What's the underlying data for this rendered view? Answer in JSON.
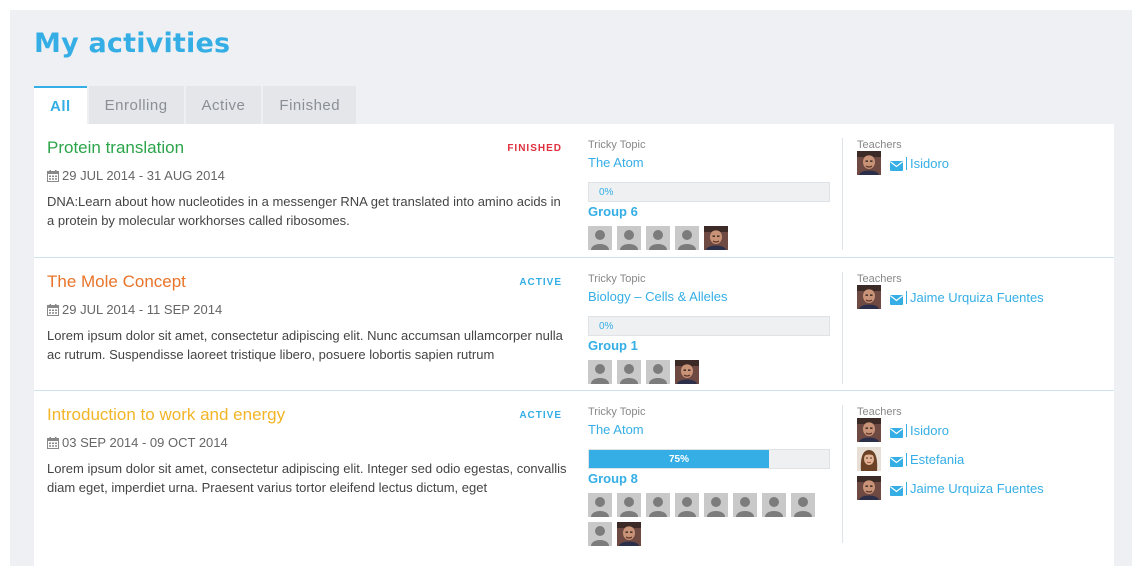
{
  "page": {
    "title": "My activities"
  },
  "tabs": [
    {
      "label": "All",
      "active": true
    },
    {
      "label": "Enrolling",
      "active": false
    },
    {
      "label": "Active",
      "active": false
    },
    {
      "label": "Finished",
      "active": false
    }
  ],
  "colors": {
    "accent": "#34aee5",
    "finished": "#e0303d",
    "active_badge": "#34aee5",
    "title_green": "#2ca44a",
    "title_orange": "#e8742a",
    "title_yellow": "#f2b527"
  },
  "labels": {
    "tricky_topic": "Tricky Topic",
    "teachers": "Teachers"
  },
  "activities": [
    {
      "title": "Protein translation",
      "title_color": "#2ca44a",
      "status": "FINISHED",
      "status_color": "#e0303d",
      "dates": "29 JUL 2014 - 31 AUG 2014",
      "description": "DNA:Learn about how nucleotides in a messenger RNA get translated into amino acids in a protein by molecular workhorses called ribosomes.",
      "topic": "The Atom",
      "progress": {
        "percent": 0,
        "label": "0%"
      },
      "group": "Group 6",
      "members": [
        "placeholder",
        "placeholder",
        "placeholder",
        "placeholder",
        "photo"
      ],
      "teachers": [
        {
          "name": "Isidoro",
          "avatar": "photo-man"
        }
      ]
    },
    {
      "title": "The Mole Concept",
      "title_color": "#e8742a",
      "status": "ACTIVE",
      "status_color": "#34aee5",
      "dates": "29 JUL 2014 - 11 SEP 2014",
      "description": "Lorem ipsum dolor sit amet, consectetur adipiscing elit. Nunc accumsan ullamcorper nulla ac rutrum. Suspendisse laoreet tristique libero, posuere lobortis sapien rutrum",
      "topic": "Biology – Cells & Alleles",
      "progress": {
        "percent": 0,
        "label": "0%"
      },
      "group": "Group 1",
      "members": [
        "placeholder",
        "placeholder",
        "placeholder",
        "photo"
      ],
      "teachers": [
        {
          "name": "Jaime Urquiza Fuentes",
          "avatar": "photo-man"
        }
      ]
    },
    {
      "title": "Introduction to work and energy",
      "title_color": "#f2b527",
      "status": "ACTIVE",
      "status_color": "#34aee5",
      "dates": "03 SEP 2014 - 09 OCT 2014",
      "description": "Lorem ipsum dolor sit amet, consectetur adipiscing elit. Integer sed odio egestas, convallis diam eget, imperdiet urna. Praesent varius tortor eleifend lectus dictum, eget",
      "topic": "The Atom",
      "progress": {
        "percent": 75,
        "label": "75%"
      },
      "group": "Group 8",
      "members": [
        "placeholder",
        "placeholder",
        "placeholder",
        "placeholder",
        "placeholder",
        "placeholder",
        "placeholder",
        "placeholder",
        "placeholder",
        "photo"
      ],
      "teachers": [
        {
          "name": "Isidoro",
          "avatar": "photo-man"
        },
        {
          "name": "Estefania",
          "avatar": "photo-woman"
        },
        {
          "name": "Jaime Urquiza Fuentes",
          "avatar": "photo-man"
        }
      ]
    }
  ]
}
